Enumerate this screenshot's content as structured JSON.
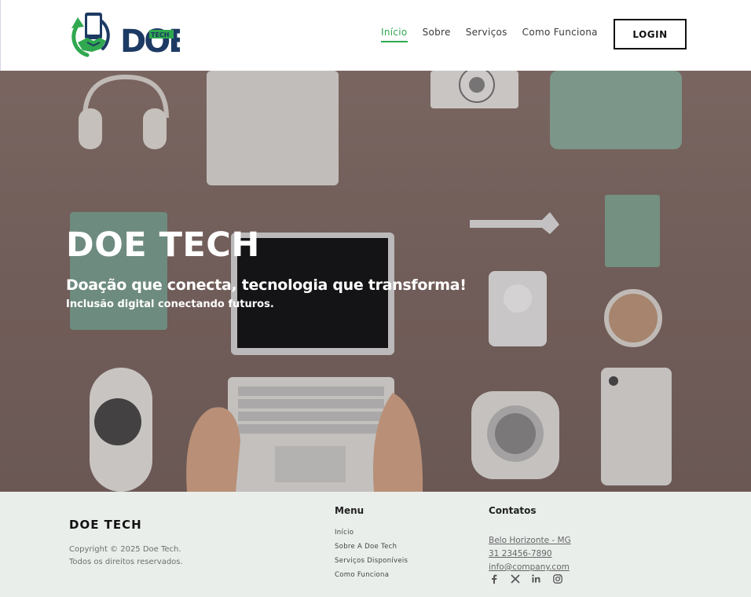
{
  "nav": {
    "logo_text": "DOE",
    "logo_badge": "TECH",
    "links": [
      {
        "label": "Início"
      },
      {
        "label": "Sobre"
      },
      {
        "label": "Serviços"
      },
      {
        "label": "Como Funciona"
      }
    ],
    "login_label": "LOGIN"
  },
  "hero": {
    "title": "DOE TECH",
    "tagline": "Doação que conecta, tecnologia que transforma!",
    "subtitle": "Inclusão digital conectando futuros."
  },
  "footer": {
    "brand": "DOE TECH",
    "copyright_line1": "Copyright © 2025 Doe Tech.",
    "copyright_line2": "Todos os direitos reservados.",
    "menu_title": "Menu",
    "menu_items": [
      "Início",
      "Sobre A Doe Tech",
      "Serviços Disponíveis",
      "Como Funciona"
    ],
    "contacts_title": "Contatos",
    "location": "Belo Horizonte - MG",
    "phone": "31 23456-7890",
    "email": "info@company.com",
    "socials": [
      "facebook-icon",
      "x-icon",
      "linkedin-icon",
      "instagram-icon"
    ]
  },
  "colors": {
    "accent": "#2fa84f",
    "brand_navy": "#1c3a63",
    "footer_bg": "#e9eeeb"
  }
}
